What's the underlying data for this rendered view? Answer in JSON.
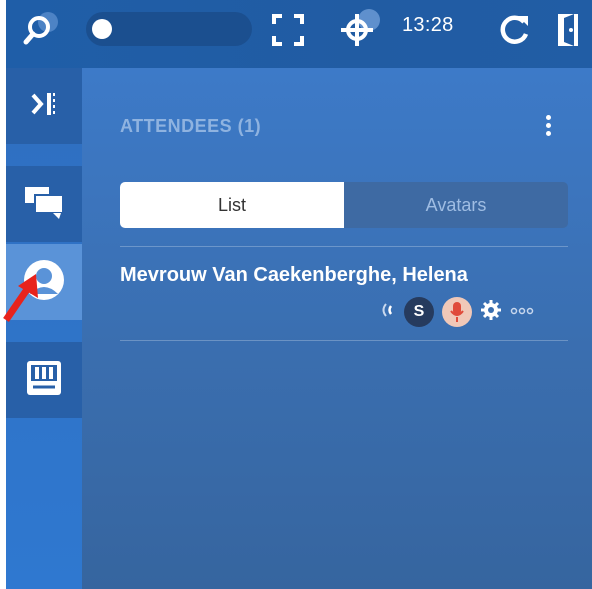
{
  "toolbar": {
    "clock": "13:28",
    "icons": [
      "search-icon",
      "fullscreen-icon",
      "crosshair-icon",
      "refresh-icon",
      "exit-icon"
    ]
  },
  "rail": {
    "items": [
      {
        "name": "collapse",
        "icon": "collapse-panel-icon"
      },
      {
        "name": "chat",
        "icon": "chat-icon"
      },
      {
        "name": "attendees",
        "icon": "person-icon",
        "active": true
      },
      {
        "name": "whiteboard",
        "icon": "toolbox-icon"
      }
    ]
  },
  "panel": {
    "heading": "ATTENDEES (1)",
    "tabs": {
      "list": "List",
      "avatars": "Avatars",
      "selected": "List"
    },
    "attendees": [
      {
        "name": "Mevrouw Van Caekenberghe, Helena",
        "initial": "S"
      }
    ]
  },
  "colors": {
    "toolbar": "#1f5ea8",
    "panel": "#3a6eaf",
    "active_rail": "#5a93d8",
    "mic_bg": "#f0c8b8",
    "mic_red": "#e04a3a",
    "arrow": "#e8231c"
  }
}
